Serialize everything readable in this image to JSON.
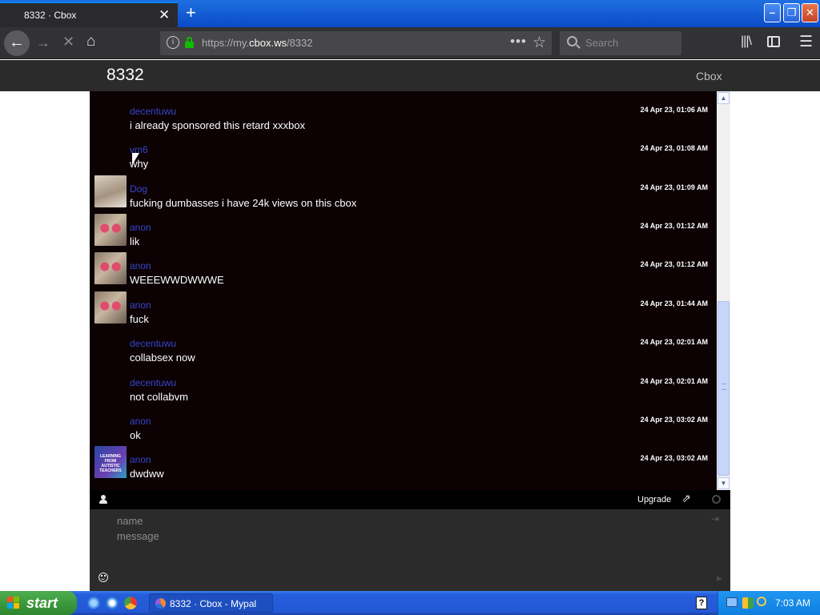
{
  "browser": {
    "tab_title": "8332 · Cbox",
    "tab_close": "✕",
    "new_tab": "+",
    "url_prefix": "https://my.",
    "url_host": "cbox.ws",
    "url_path": "/8332",
    "search_placeholder": "Search"
  },
  "page": {
    "title": "8332",
    "brand": "Cbox"
  },
  "messages": [
    {
      "user": "decentuwu",
      "text": "i already sponsored this retard xxxbox",
      "time": "24 Apr 23, 01:06 AM",
      "avatar": "none"
    },
    {
      "user": "vm6",
      "text": "why",
      "time": "24 Apr 23, 01:08 AM",
      "avatar": "none"
    },
    {
      "user": "Dog",
      "text": "fucking dumbasses i have 24k views on this cbox",
      "time": "24 Apr 23, 01:09 AM",
      "avatar": "dog"
    },
    {
      "user": "anon",
      "text": "lik",
      "time": "24 Apr 23, 01:12 AM",
      "avatar": "cat"
    },
    {
      "user": "anon",
      "text": "WEEEWWDWWWE",
      "time": "24 Apr 23, 01:12 AM",
      "avatar": "cat"
    },
    {
      "user": "anon",
      "text": "fuck",
      "time": "24 Apr 23, 01:44 AM",
      "avatar": "cat"
    },
    {
      "user": "decentuwu",
      "text": "collabsex now",
      "time": "24 Apr 23, 02:01 AM",
      "avatar": "none"
    },
    {
      "user": "decentuwu",
      "text": "not collabvm",
      "time": "24 Apr 23, 02:01 AM",
      "avatar": "none"
    },
    {
      "user": "anon",
      "text": "ok",
      "time": "24 Apr 23, 03:02 AM",
      "avatar": "none"
    },
    {
      "user": "anon",
      "text": "dwdww",
      "time": "24 Apr 23, 03:02 AM",
      "avatar": "book"
    }
  ],
  "avatar_book_text": "LEARNING FROM AUTISTIC TEACHERS",
  "toolbar": {
    "upgrade_label": "Upgrade"
  },
  "form": {
    "name_placeholder": "name",
    "message_placeholder": "message"
  },
  "taskbar": {
    "start_label": "start",
    "task_label": "8332 · Cbox - Mypal",
    "help": "?",
    "clock": "7:03 AM"
  },
  "colors": {
    "username": "#3745c9",
    "chat_bg": "#0c0204",
    "secure_lock": "#12bc00"
  }
}
